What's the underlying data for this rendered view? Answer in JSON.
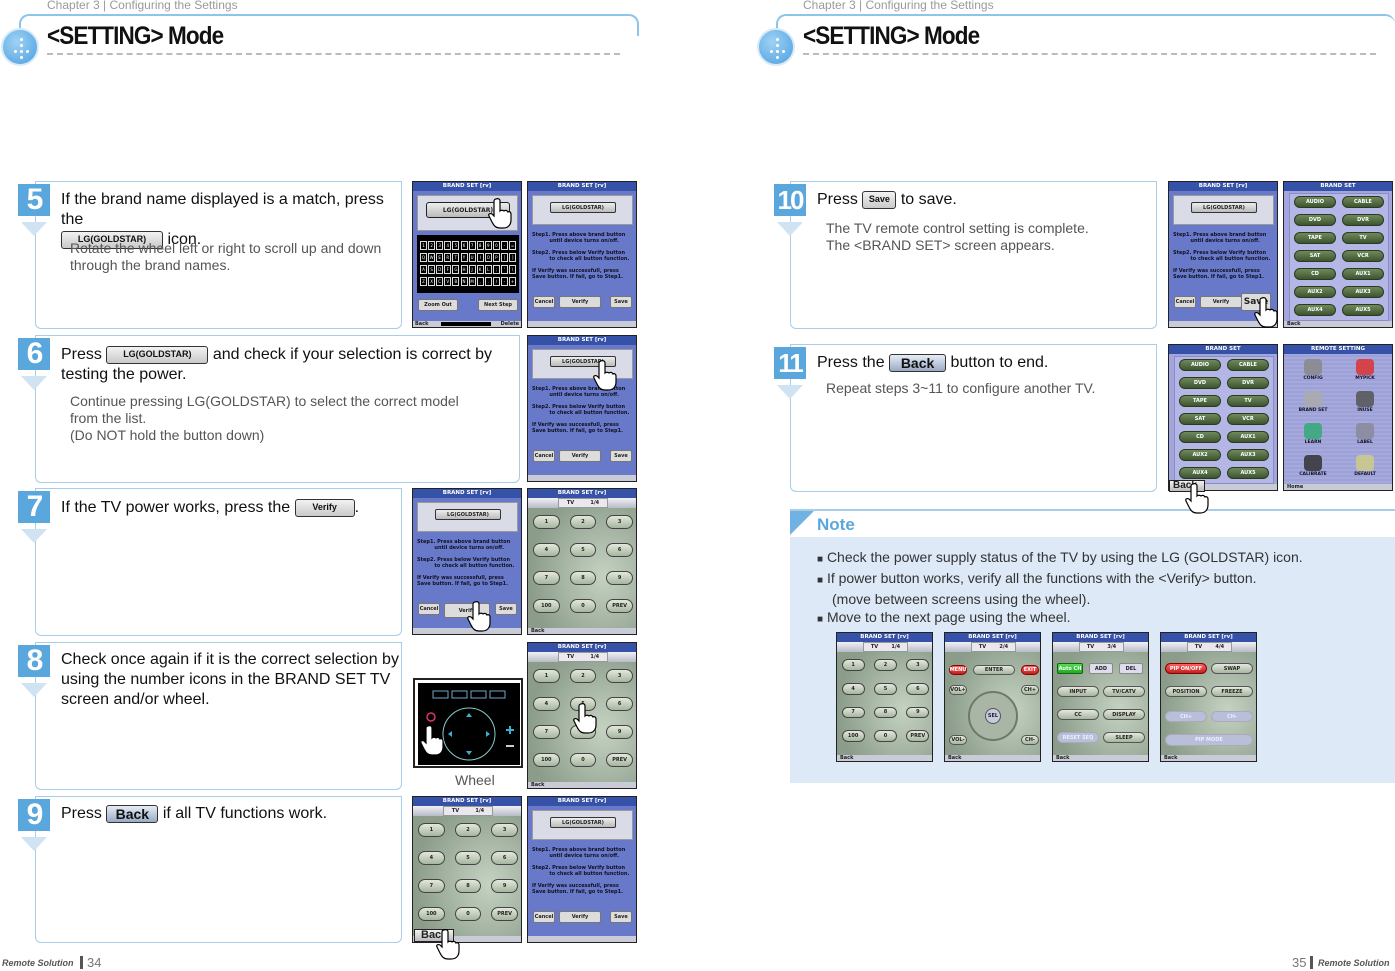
{
  "pages": [
    {
      "chapter": "Chapter 3 | Configuring the Settings",
      "title": "<SETTING> Mode",
      "footer_brand": "Remote Solution",
      "page_number": "34"
    },
    {
      "chapter": "Chapter 3 | Configuring the Settings",
      "title": "<SETTING> Mode",
      "footer_brand": "Remote Solution",
      "page_number": "35"
    }
  ],
  "buttons": {
    "lg": "LG(GOLDSTAR)",
    "verify": "Verify",
    "back": "Back",
    "save": "Save"
  },
  "steps": {
    "s5": {
      "num": "5",
      "pre": "If the brand name displayed is a match, press the",
      "post": "icon.",
      "sub": [
        "Rotate the wheel left or right to scroll up and down",
        "through the brand names."
      ]
    },
    "s6": {
      "num": "6",
      "pre": "Press",
      "post": "and check if your selection is correct by",
      "line2": "testing the power.",
      "sub": [
        "Continue pressing  LG(GOLDSTAR)  to select the correct model",
        "from the list.",
        "(Do NOT hold the button down)"
      ]
    },
    "s7": {
      "num": "7",
      "pre": "If the TV power works, press the",
      "post": "."
    },
    "s8": {
      "num": "8",
      "lines": [
        "Check once again if it is the correct selection by",
        "using the number icons in the BRAND SET TV",
        "screen and/or wheel."
      ],
      "wheel_caption": "Wheel"
    },
    "s9": {
      "num": "9",
      "pre": "Press",
      "post": "if all TV functions work."
    },
    "s10": {
      "num": "10",
      "pre": "Press",
      "post": "to save.",
      "sub": [
        "The TV remote control setting is complete.",
        "The <BRAND SET> screen appears."
      ]
    },
    "s11": {
      "num": "11",
      "pre": "Press the",
      "post": "button to end.",
      "sub": [
        "Repeat steps 3~11 to configure another TV."
      ]
    }
  },
  "note": {
    "title": "Note",
    "items": [
      "Check the power supply status of the TV by using the LG (GOLDSTAR) icon.",
      "If power button works, verify all the functions with the <Verify> button.",
      "(move between screens using the wheel).",
      "Move to the next page using the wheel."
    ]
  },
  "screens": {
    "brand_title": "BRAND SET  [rv]",
    "brand_title_plain": "BRAND SET",
    "remote_title": "REMOTE SETTING",
    "lg": "LG(GOLDSTAR)",
    "verify_text": "Step1. Press above brand button\n          until device turns on/off.\n\nStep2. Press below Verify button\n          to check all button function.\n\nIf Verify was successfull, press\nSave button. If fail, go to Step1.",
    "verify_buttons": [
      "Cancel",
      "Verify",
      "Save"
    ],
    "keyboard_rows": [
      [
        "1",
        "2",
        "3",
        "4",
        "5",
        "6",
        "7",
        "8",
        "9",
        "0",
        "-",
        "="
      ],
      [
        "Q",
        "W",
        "E",
        "R",
        "T",
        "Y",
        "U",
        "I",
        "O",
        "P",
        "[",
        "]"
      ],
      [
        "A",
        "S",
        "D",
        "F",
        "G",
        "H",
        "J",
        "K",
        "L",
        ";",
        "'",
        "\\"
      ],
      [
        "Z",
        "X",
        "C",
        "V",
        "B",
        "N",
        "M",
        ",",
        ".",
        "/",
        "-",
        "+"
      ]
    ],
    "keyboard_buttons": [
      "Zoom Out",
      "Next Step"
    ],
    "keyboard_bottom": [
      "Back",
      "Delete"
    ],
    "tab": [
      "TV",
      "1/4"
    ],
    "keypad": [
      "1",
      "2",
      "3",
      "4",
      "5",
      "6",
      "7",
      "8",
      "9",
      "100",
      "0",
      "PREV"
    ],
    "brands": [
      "AUDIO",
      "CABLE",
      "DVD",
      "DVR",
      "TAPE",
      "TV",
      "SAT",
      "VCR",
      "CD",
      "AUX1",
      "AUX2",
      "AUX3",
      "AUX4",
      "AUX5"
    ],
    "remote_items": [
      "CONFIG",
      "MYPICK",
      "BRAND SET",
      "INUSE",
      "LEARN",
      "LABEL",
      "CALIBRATE",
      "DEFAULT"
    ],
    "back": "Back",
    "home": "Home",
    "thumb2": {
      "tab": [
        "TV",
        "2/4"
      ],
      "buttons": [
        "MENU",
        "ENTER",
        "EXIT",
        "VOL+",
        "CH+",
        "SEL",
        "VOL-",
        "CH-"
      ]
    },
    "thumb3": {
      "tab": [
        "TV",
        "3/4"
      ],
      "buttons": [
        "Auto CH",
        "ADD",
        "DEL",
        "INPUT",
        "TV/CATV",
        "CC",
        "DISPLAY",
        "RESET SEQ",
        "SLEEP"
      ]
    },
    "thumb4": {
      "tab": [
        "TV",
        "4/4"
      ],
      "buttons": [
        "PIP ON/OFF",
        "SWAP",
        "POSITION",
        "FREEZE",
        "CH+",
        "CH-",
        "PIP MODE"
      ]
    }
  },
  "colors": {
    "accent": "#5aa7dd",
    "note_bg": "#dde9f7",
    "note_title": "#5aa7dd",
    "screen_blue": "#6779c8",
    "keypad_bg": "#8b9c8a",
    "brand_bg": "#a3a6dc"
  }
}
